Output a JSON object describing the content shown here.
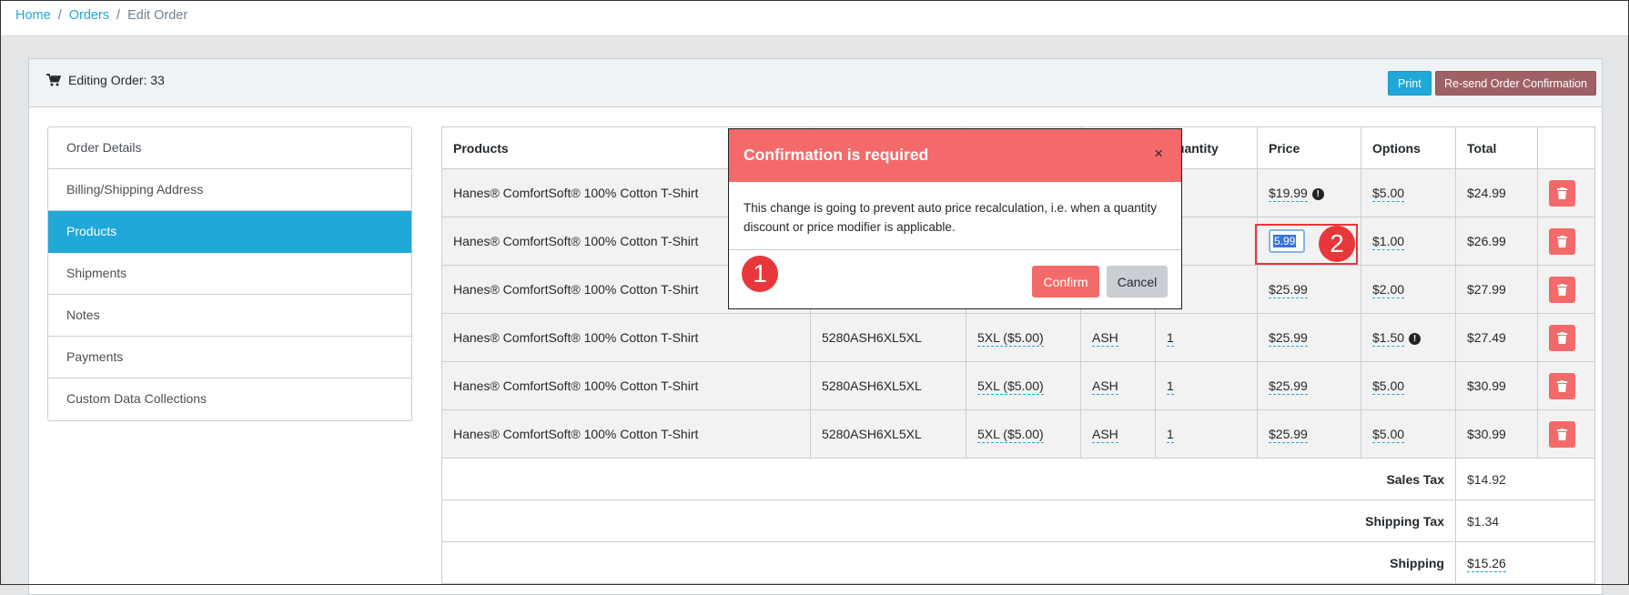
{
  "breadcrumb": {
    "home": "Home",
    "orders": "Orders",
    "current": "Edit Order",
    "sep": "/"
  },
  "card": {
    "title": "Editing Order: 33",
    "print_label": "Print",
    "resend_label": "Re-send Order Confirmation"
  },
  "sidebar": {
    "items": [
      {
        "label": "Order Details"
      },
      {
        "label": "Billing/Shipping Address"
      },
      {
        "label": "Products"
      },
      {
        "label": "Shipments"
      },
      {
        "label": "Notes"
      },
      {
        "label": "Payments"
      },
      {
        "label": "Custom Data Collections"
      }
    ]
  },
  "table": {
    "headers": {
      "products": "Products",
      "quantity": "Quantity",
      "price": "Price",
      "options": "Options",
      "total": "Total"
    },
    "rows": [
      {
        "product": "Hanes® ComfortSoft® 100% Cotton T-Shirt",
        "sku": "",
        "size": "",
        "color": "",
        "qty": "",
        "price": "$19.99",
        "options": "$5.00",
        "total": "$24.99"
      },
      {
        "product": "Hanes® ComfortSoft® 100% Cotton T-Shirt",
        "sku": "",
        "size": "",
        "color": "",
        "qty": "",
        "price_editing": "5.99",
        "options": "$1.00",
        "total": "$26.99"
      },
      {
        "product": "Hanes® ComfortSoft® 100% Cotton T-Shirt",
        "sku": "",
        "size": "",
        "color": "",
        "qty": "",
        "price": "$25.99",
        "options": "$2.00",
        "total": "$27.99"
      },
      {
        "product": "Hanes® ComfortSoft® 100% Cotton T-Shirt",
        "sku": "5280ASH6XL5XL",
        "size": "5XL ($5.00)",
        "color": "ASH",
        "qty": "1",
        "price": "$25.99",
        "options": "$1.50",
        "total": "$27.49"
      },
      {
        "product": "Hanes® ComfortSoft® 100% Cotton T-Shirt",
        "sku": "5280ASH6XL5XL",
        "size": "5XL ($5.00)",
        "color": "ASH",
        "qty": "1",
        "price": "$25.99",
        "options": "$5.00",
        "total": "$30.99"
      },
      {
        "product": "Hanes® ComfortSoft® 100% Cotton T-Shirt",
        "sku": "5280ASH6XL5XL",
        "size": "5XL ($5.00)",
        "color": "ASH",
        "qty": "1",
        "price": "$25.99",
        "options": "$5.00",
        "total": "$30.99"
      }
    ],
    "summary": [
      {
        "label": "Sales Tax",
        "value": "$14.92"
      },
      {
        "label": "Shipping Tax",
        "value": "$1.34"
      },
      {
        "label": "Shipping",
        "value": "$15.26"
      }
    ]
  },
  "modal": {
    "title": "Confirmation is required",
    "close": "×",
    "body": "This change is going to prevent auto price recalculation, i.e. when a quantity discount or price modifier is applicable.",
    "confirm_label": "Confirm",
    "cancel_label": "Cancel"
  },
  "annotations": {
    "one": "1",
    "two": "2"
  },
  "icons": {
    "info": "!"
  },
  "colors": {
    "primary": "#20a8d8",
    "danger": "#f46a6a",
    "resend": "#a06166",
    "annotation": "#e8373a"
  }
}
